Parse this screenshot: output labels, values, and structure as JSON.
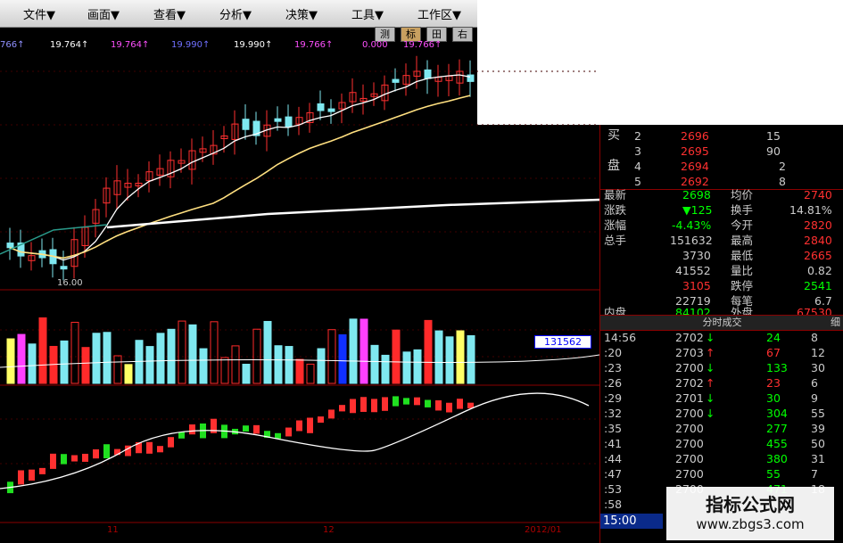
{
  "menu": [
    "文件▼",
    "画面▼",
    "查看▼",
    "分析▼",
    "决策▼",
    "工具▼",
    "工作区▼"
  ],
  "toolbar": {
    "btn1": "测",
    "btn2": "标",
    "btn3": "田",
    "btn4": "右"
  },
  "ticker": [
    "766↑",
    "19.764↑",
    "19.764↑",
    "19.990↑",
    "19.990↑",
    "19.766↑",
    "0.000",
    "19.766↑"
  ],
  "low_marker": "16.00",
  "volume_label": "131562",
  "axis": {
    "m11": "11",
    "m12": "12",
    "m2012": "2012/01"
  },
  "quote": {
    "bid_label_1": "买",
    "bid_label_2": "盘",
    "bids": [
      {
        "lvl": "2",
        "price": "2696",
        "vol": "15"
      },
      {
        "lvl": "3",
        "price": "2695",
        "vol": "90"
      },
      {
        "lvl": "4",
        "price": "2694",
        "vol": "2"
      },
      {
        "lvl": "5",
        "price": "2692",
        "vol": "8"
      }
    ],
    "rows": [
      {
        "l1": "最新",
        "v1": "2698",
        "l2": "均价",
        "v2": "2740"
      },
      {
        "l1": "涨跌",
        "v1": "▼125",
        "l2": "换手",
        "v2": "14.81%"
      },
      {
        "l1": "涨幅",
        "v1": "-4.43%",
        "l2": "今开",
        "v2": "2820"
      },
      {
        "l1": "总手",
        "v1": "151632",
        "l2": "最高",
        "v2": "2840"
      },
      {
        "l1": "",
        "v1": "3730",
        "l2": "最低",
        "v2": "2665"
      },
      {
        "l1": "",
        "v1": "41552",
        "l2": "量比",
        "v2": "0.82"
      },
      {
        "l1": "",
        "v1": "3105",
        "l2": "跌停",
        "v2": "2541"
      },
      {
        "l1": "",
        "v1": "22719",
        "l2": "每笔",
        "v2": "6.7"
      },
      {
        "l1": "内盘",
        "v1": "84102",
        "l2": "外盘",
        "v2": "67530"
      }
    ],
    "section_title": "分时成交",
    "section_btn": "细",
    "ticks": [
      {
        "t": "14:56",
        "p": "2702",
        "d": "down",
        "v": "24",
        "n": "8"
      },
      {
        "t": ":20",
        "p": "2703",
        "d": "up",
        "v": "67",
        "n": "12"
      },
      {
        "t": ":23",
        "p": "2700",
        "d": "down",
        "v": "133",
        "n": "30"
      },
      {
        "t": ":26",
        "p": "2702",
        "d": "up",
        "v": "23",
        "n": "6"
      },
      {
        "t": ":29",
        "p": "2701",
        "d": "down",
        "v": "30",
        "n": "9"
      },
      {
        "t": ":32",
        "p": "2700",
        "d": "down",
        "v": "304",
        "n": "55"
      },
      {
        "t": ":35",
        "p": "2700",
        "d": "",
        "v": "277",
        "n": "39"
      },
      {
        "t": ":41",
        "p": "2700",
        "d": "",
        "v": "455",
        "n": "50"
      },
      {
        "t": ":44",
        "p": "2700",
        "d": "",
        "v": "380",
        "n": "31"
      },
      {
        "t": ":47",
        "p": "2700",
        "d": "",
        "v": "55",
        "n": "7"
      },
      {
        "t": ":53",
        "p": "2700",
        "d": "",
        "v": "471",
        "n": "18"
      },
      {
        "t": ":58",
        "p": "",
        "d": "",
        "v": "",
        "n": ""
      }
    ],
    "close_time": "15:00"
  },
  "watermark": {
    "line1": "指标公式网",
    "line2": "www.zbgs3.com"
  },
  "colors": {
    "up": "#ff3030",
    "down": "#7fe8f0",
    "ma_white": "#ffffff",
    "ma_yellow": "#ffe080",
    "price_red": "#ff3030",
    "price_green": "#00ff00",
    "vol_red": "#ff2a2a",
    "vol_cyan": "#7fe8f0",
    "vol_magenta": "#ff40ff",
    "vol_blue": "#1030ff",
    "vol_yellow": "#ffff66"
  }
}
